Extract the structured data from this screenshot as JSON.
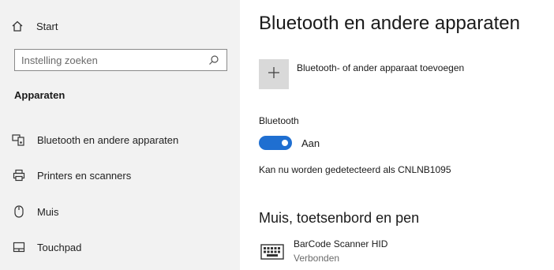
{
  "sidebar": {
    "start_label": "Start",
    "search": {
      "placeholder": "Instelling zoeken",
      "value": ""
    },
    "heading": "Apparaten",
    "items": [
      {
        "label": "Bluetooth en andere apparaten",
        "icon": "bluetooth-devices-icon"
      },
      {
        "label": "Printers en scanners",
        "icon": "printer-icon"
      },
      {
        "label": "Muis",
        "icon": "mouse-icon"
      },
      {
        "label": "Touchpad",
        "icon": "touchpad-icon"
      }
    ]
  },
  "main": {
    "title": "Bluetooth en andere apparaten",
    "add_device_label": "Bluetooth- of ander apparaat toevoegen",
    "bluetooth": {
      "label": "Bluetooth",
      "state": "Aan",
      "on": true
    },
    "discoverable_text": "Kan nu worden gedetecteerd als CNLNB1095",
    "section_title": "Muis, toetsenbord en pen",
    "devices": [
      {
        "name": "BarCode Scanner HID",
        "status": "Verbonden",
        "icon": "keyboard-icon"
      }
    ]
  },
  "colors": {
    "sidebar_bg": "#f2f2f2",
    "accent": "#1f6fd1",
    "add_button_bg": "#d9d9d9"
  }
}
